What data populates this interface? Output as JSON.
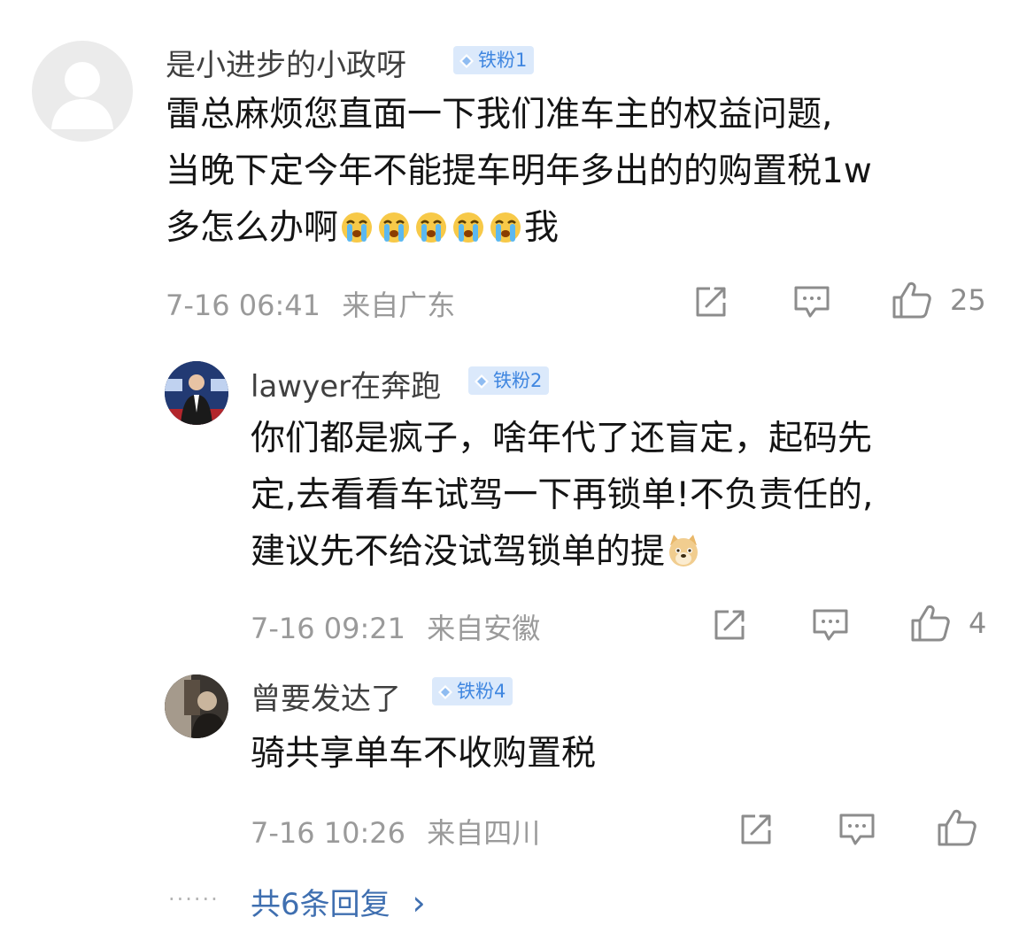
{
  "comments": [
    {
      "username": "是小进步的小政呀",
      "badge": "铁粉1",
      "text_lines": [
        "雷总麻烦您直面一下我们准车主的权益问题,",
        "当晚下定今年不能提车明年多出的的购置税1w",
        "多怎么办啊"
      ],
      "text_tail": "我",
      "emoji": "crying-face",
      "timestamp": "7-16 06:41",
      "location": "来自广东",
      "like_count": "25"
    },
    {
      "username": "lawyer在奔跑",
      "badge": "铁粉2",
      "text_lines": [
        "你们都是疯子，啥年代了还盲定，起码先",
        "定,去看看车试驾一下再锁单!不负责任的,",
        "建议先不给没试驾锁单的提"
      ],
      "emoji": "doge-face",
      "timestamp": "7-16 09:21",
      "location": "来自安徽",
      "like_count": "4"
    },
    {
      "username": "曾要发达了",
      "badge": "铁粉4",
      "text_lines": [
        "骑共享单车不收购置税"
      ],
      "timestamp": "7-16 10:26",
      "location": "来自四川",
      "like_count": ""
    }
  ],
  "more_replies": {
    "dots": "······",
    "label": "共6条回复",
    "chevron": "›"
  },
  "colors": {
    "badge_bg": "#dbe9fb",
    "badge_text": "#3f86e0",
    "link": "#3f6fb0",
    "meta": "#9a9a9a"
  }
}
